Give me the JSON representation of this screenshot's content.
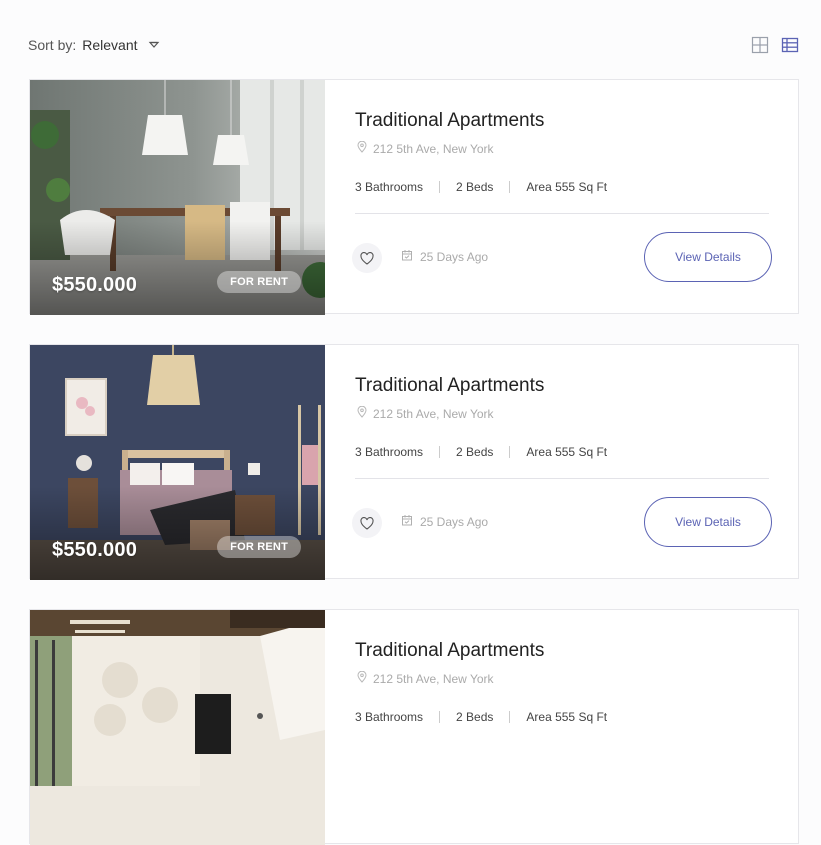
{
  "sort": {
    "label": "Sort by:",
    "value": "Relevant"
  },
  "view_toggles": {
    "grid_icon": "grid-view-icon",
    "list_icon": "list-view-icon"
  },
  "colors": {
    "accent": "#5b63b4",
    "muted": "#aaaaaa"
  },
  "listings": [
    {
      "price": "$550.000",
      "badge": "FOR RENT",
      "title": "Traditional Apartments",
      "address": "212 5th Ave, New York",
      "bathrooms": "3 Bathrooms",
      "beds": "2 Beds",
      "area": "Area 555 Sq Ft",
      "date": "25 Days Ago",
      "button": "View Details"
    },
    {
      "price": "$550.000",
      "badge": "FOR RENT",
      "title": "Traditional Apartments",
      "address": "212 5th Ave, New York",
      "bathrooms": "3 Bathrooms",
      "beds": "2 Beds",
      "area": "Area 555 Sq Ft",
      "date": "25 Days Ago",
      "button": "View Details"
    },
    {
      "title": "Traditional Apartments",
      "address": "212 5th Ave, New York",
      "bathrooms": "3 Bathrooms",
      "beds": "2 Beds",
      "area": "Area 555 Sq Ft"
    }
  ]
}
